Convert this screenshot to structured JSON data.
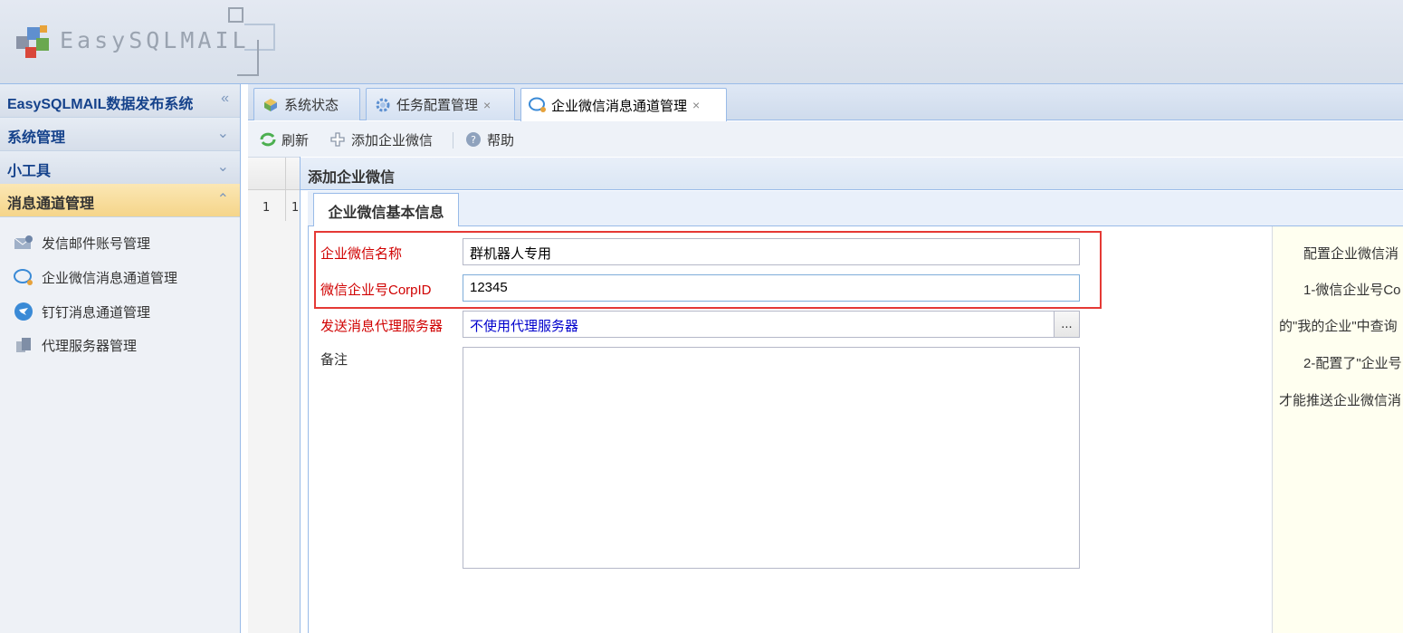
{
  "app": {
    "logo_text": "EasySQLMAIL"
  },
  "sidebar": {
    "header_title": "EasySQLMAIL数据发布系统",
    "sections": [
      {
        "label": "系统管理"
      },
      {
        "label": "小工具"
      },
      {
        "label": "消息通道管理"
      }
    ],
    "items": [
      {
        "label": "发信邮件账号管理",
        "icon": "mail-account-icon"
      },
      {
        "label": "企业微信消息通道管理",
        "icon": "wechat-chat-icon"
      },
      {
        "label": "钉钉消息通道管理",
        "icon": "dingtalk-icon"
      },
      {
        "label": "代理服务器管理",
        "icon": "proxy-server-icon"
      }
    ]
  },
  "tabs": [
    {
      "label": "系统状态",
      "closable": false
    },
    {
      "label": "任务配置管理",
      "closable": true
    },
    {
      "label": "企业微信消息通道管理",
      "closable": true,
      "active": true
    }
  ],
  "tab_close_glyph": "×",
  "toolbar": {
    "refresh_label": "刷新",
    "add_label": "添加企业微信",
    "help_label": "帮助"
  },
  "grid": {
    "row_number": "1",
    "first_cell": "1"
  },
  "dialog": {
    "title": "添加企业微信",
    "tab_label": "企业微信基本信息",
    "fields": {
      "name_label": "企业微信名称",
      "name_value": "群机器人专用",
      "corpid_label": "微信企业号CorpID",
      "corpid_value": "12345",
      "proxy_label": "发送消息代理服务器",
      "proxy_value": "不使用代理服务器",
      "proxy_button": "...",
      "remark_label": "备注",
      "remark_value": ""
    },
    "help_lines": [
      "配置企业微信消",
      "1-微信企业号Co",
      "的\"我的企业\"中查询",
      "2-配置了\"企业号",
      "才能推送企业微信消"
    ]
  },
  "colors": {
    "required_label": "#d00000",
    "highlight_box": "#e53935",
    "proxy_value": "#0000cc"
  }
}
